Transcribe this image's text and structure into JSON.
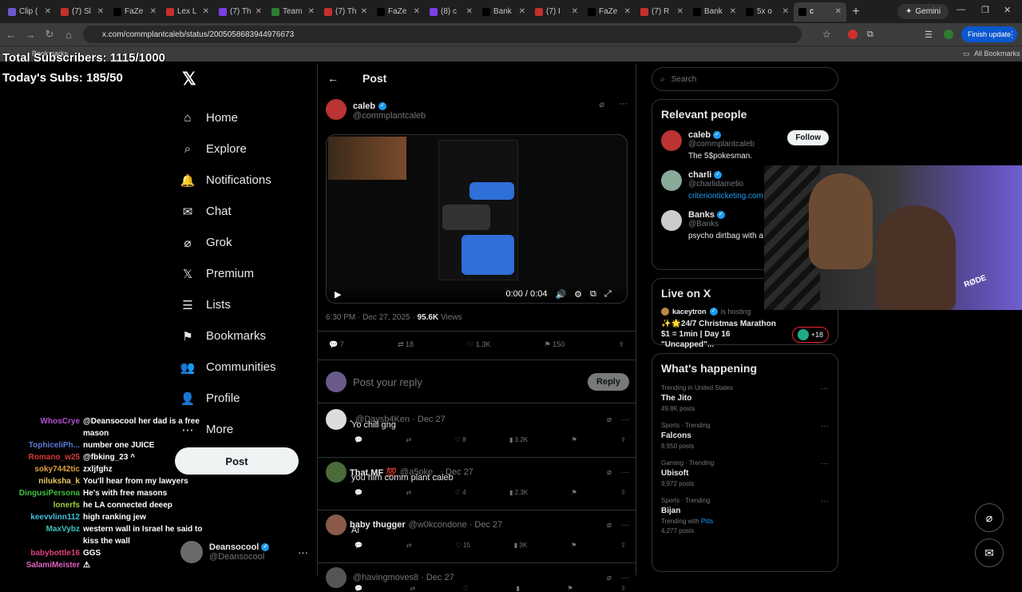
{
  "browser": {
    "tabs": [
      {
        "title": "Clip (",
        "fav": "#6e56cf"
      },
      {
        "title": "(7) Sl",
        "fav": "#c4302b"
      },
      {
        "title": "FaZe",
        "fav": "#000000"
      },
      {
        "title": "Lex L",
        "fav": "#c4302b"
      },
      {
        "title": "(7) Th",
        "fav": "#7b3fe4"
      },
      {
        "title": "Team",
        "fav": "#2e7d32"
      },
      {
        "title": "(7) Th",
        "fav": "#c4302b"
      },
      {
        "title": "FaZe",
        "fav": "#000000"
      },
      {
        "title": "(8) c",
        "fav": "#7b3fe4"
      },
      {
        "title": "Bank",
        "fav": "#000000"
      },
      {
        "title": "(7) I",
        "fav": "#c4302b"
      },
      {
        "title": "FaZe",
        "fav": "#000000"
      },
      {
        "title": "(7) R",
        "fav": "#c4302b"
      },
      {
        "title": "Bank",
        "fav": "#000000"
      },
      {
        "title": "5x o",
        "fav": "#000000"
      },
      {
        "title": "c",
        "fav": "#000000"
      }
    ],
    "gemini_label": "Gemini",
    "url": "x.com/commplantcaleb/status/2005058683944976673",
    "finish_update": "Finish update",
    "bookmarks_label": "Bookmarks",
    "all_bookmarks": "All Bookmarks"
  },
  "overlay": {
    "total_subs": "Total Subscribers: 1115/1000",
    "today_subs": "Today's Subs: 185/50"
  },
  "nav": {
    "items": [
      {
        "label": "Home",
        "icon": "home-icon"
      },
      {
        "label": "Explore",
        "icon": "search-icon"
      },
      {
        "label": "Notifications",
        "icon": "bell-icon"
      },
      {
        "label": "Chat",
        "icon": "mail-icon"
      },
      {
        "label": "Grok",
        "icon": "grok-icon"
      },
      {
        "label": "Premium",
        "icon": "x-icon"
      },
      {
        "label": "Lists",
        "icon": "list-icon"
      },
      {
        "label": "Bookmarks",
        "icon": "bookmark-icon"
      },
      {
        "label": "Communities",
        "icon": "people-icon"
      },
      {
        "label": "Profile",
        "icon": "person-icon"
      },
      {
        "label": "More",
        "icon": "more-icon"
      }
    ],
    "post_button": "Post",
    "profile": {
      "name": "Deansocool",
      "handle": "@Deansocool"
    }
  },
  "main": {
    "header": "Post",
    "author": {
      "name": "caleb",
      "handle": "@commplantcaleb"
    },
    "video_time": "0:00 / 0:04",
    "time": "6:30 PM · Dec 27, 2025 ·",
    "views_count": "95.6K",
    "views_label": "Views",
    "stats": {
      "replies": "7",
      "reposts": "18",
      "likes": "1.3K",
      "bookmarks": "150"
    },
    "reply_placeholder": "Post your reply",
    "reply_button": "Reply",
    "replies": [
      {
        "name": ".",
        "handle": "@Daysb4Ken · Dec 27",
        "text": "Yo chill gng",
        "likes": "8",
        "views": "3.2K",
        "color": "#ddd"
      },
      {
        "name": "That MF 💯",
        "handle": "@a5oke_ · Dec 27",
        "text": "you him comm plant caleb",
        "likes": "4",
        "views": "2.3K",
        "color": "#4a6b3a"
      },
      {
        "name": "baby thugger",
        "handle": "@w0kcondone · Dec 27",
        "text": "Ai",
        "likes": "15",
        "views": "3K",
        "color": "#8a5a4a"
      },
      {
        "name": "",
        "handle": "@havingmoves8 · Dec 27",
        "text": "",
        "likes": "",
        "views": "",
        "color": "#555"
      }
    ]
  },
  "right": {
    "search_placeholder": "Search",
    "relevant_title": "Relevant people",
    "people": [
      {
        "name": "caleb",
        "handle": "@commplantcaleb",
        "bio": "The 5$pokesman.",
        "follow": "Follow"
      },
      {
        "name": "charli",
        "handle": "@charlidamelio",
        "bio": "criterionticketing.com",
        "follow": ""
      },
      {
        "name": "Banks",
        "handle": "@Banks",
        "bio": "psycho dirtbag with a",
        "follow": ""
      }
    ],
    "live_title": "Live on X",
    "live": {
      "host": "kaceytron",
      "hosting": "is hosting",
      "title": "✨🌟24/7 Christmas Marathon $1 = 1min | Day 16 \"Uncapped\"...",
      "count": "+18"
    },
    "happening_title": "What's happening",
    "trends": [
      {
        "cat": "Trending in United States",
        "title": "The Jito",
        "count": "49.8K posts"
      },
      {
        "cat": "Sports · Trending",
        "title": "Falcons",
        "count": "8,950 posts"
      },
      {
        "cat": "Gaming · Trending",
        "title": "Ubisoft",
        "count": "9,972 posts"
      },
      {
        "cat": "Sports · Trending",
        "title": "Bijan",
        "count": "4,277 posts",
        "with": "Trending with",
        "with_tag": "Pitts"
      }
    ]
  },
  "chat": [
    {
      "user": "WhosCrye",
      "msg": "@Deansocool her dad is a free",
      "color": "#b44fd6"
    },
    {
      "user": "",
      "msg": "mason",
      "color": "#fff"
    },
    {
      "user": "TophiceliPh...",
      "msg": "number one JUICE",
      "color": "#5a7bd6"
    },
    {
      "user": "Romano_w25",
      "msg": "@fbking_23 ^",
      "color": "#d63b3b"
    },
    {
      "user": "soky7442tic",
      "msg": "zxljfghz",
      "color": "#e0a040"
    },
    {
      "user": "niluksha_k",
      "msg": "You'll hear from my lawyers",
      "color": "#e8c860"
    },
    {
      "user": "DingusiPersona",
      "msg": "He's with free masons",
      "color": "#40c040"
    },
    {
      "user": "lonerfs",
      "msg": "he LA connected deeep",
      "color": "#a0d040"
    },
    {
      "user": "keevvlinn112",
      "msg": "high ranking jew",
      "color": "#40c0e0"
    },
    {
      "user": "MaxVybz",
      "msg": "western wall in Israel he said to",
      "color": "#40c0c0"
    },
    {
      "user": "",
      "msg": "kiss the wall",
      "color": "#fff"
    },
    {
      "user": "babybottle16",
      "msg": "GGS",
      "color": "#e04080"
    },
    {
      "user": "SalamiMeister",
      "msg": "⚠",
      "color": "#e060c0"
    }
  ],
  "webcam": {
    "mic_label": "RØDE"
  }
}
